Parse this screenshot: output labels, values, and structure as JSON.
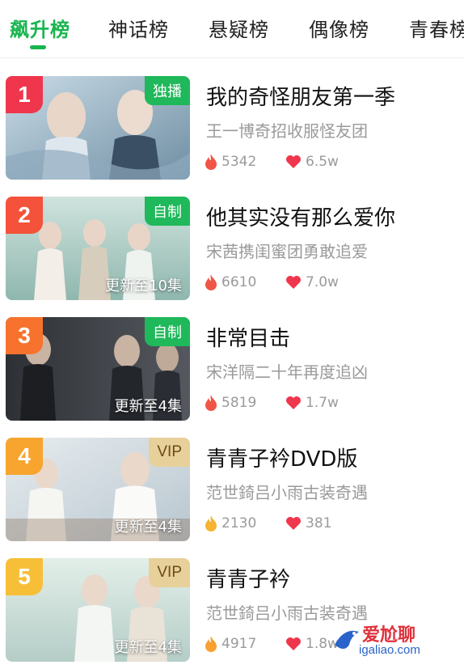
{
  "tabs": [
    {
      "label": "飙升榜",
      "active": true
    },
    {
      "label": "神话榜",
      "active": false
    },
    {
      "label": "悬疑榜",
      "active": false
    },
    {
      "label": "偶像榜",
      "active": false
    },
    {
      "label": "青春榜",
      "active": false
    }
  ],
  "accent_color": "#18b54f",
  "rank_colors": [
    "#f0364c",
    "#f4523a",
    "#f7732d",
    "#f7a52e",
    "#f7bf38"
  ],
  "items": [
    {
      "rank": "1",
      "badge": "独播",
      "badge_type": "green",
      "status": "",
      "title": "我的奇怪朋友第一季",
      "subtitle": "王一博奇招收服怪友团",
      "play_count": "5342",
      "like_count": "6.5w",
      "play_icon": "flame-icon"
    },
    {
      "rank": "2",
      "badge": "自制",
      "badge_type": "green",
      "status": "更新至10集",
      "title": "他其实没有那么爱你",
      "subtitle": "宋茜携闺蜜团勇敢追爱",
      "play_count": "6610",
      "like_count": "7.0w",
      "play_icon": "flame-icon"
    },
    {
      "rank": "3",
      "badge": "自制",
      "badge_type": "green",
      "status": "更新至4集",
      "title": "非常目击",
      "subtitle": "宋洋隔二十年再度追凶",
      "play_count": "5819",
      "like_count": "1.7w",
      "play_icon": "flame-icon"
    },
    {
      "rank": "4",
      "badge": "VIP",
      "badge_type": "vip",
      "status": "更新至4集",
      "title": "青青子衿DVD版",
      "subtitle": "范世錡吕小雨古装奇遇",
      "play_count": "2130",
      "like_count": "381",
      "play_icon": "flame-icon"
    },
    {
      "rank": "5",
      "badge": "VIP",
      "badge_type": "vip",
      "status": "更新至4集",
      "title": "青青子衿",
      "subtitle": "范世錡吕小雨古装奇遇",
      "play_count": "4917",
      "like_count": "1.8w",
      "play_icon": "flame-icon"
    }
  ],
  "watermark": {
    "text": "爱尬聊",
    "url": "igaliao.com"
  }
}
